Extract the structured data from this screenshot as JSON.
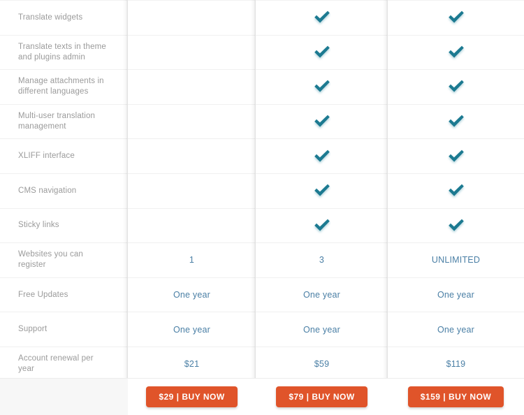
{
  "colors": {
    "feature_label": "#9a9a9a",
    "plan_value": "#4a7fa5",
    "check": "#1f7a91",
    "button_bg": "#e0542a",
    "button_text": "#ffffff",
    "row_divider": "#f0f0f0",
    "footer_bg": "#f7f7f7"
  },
  "features": [
    {
      "label": "Translate widgets"
    },
    {
      "label": "Translate texts in theme and plugins admin"
    },
    {
      "label": "Manage attachments in different languages"
    },
    {
      "label": "Multi-user translation management"
    },
    {
      "label": "XLIFF interface"
    },
    {
      "label": "CMS navigation"
    },
    {
      "label": "Sticky links"
    },
    {
      "label": "Websites you can register"
    },
    {
      "label": "Free Updates"
    },
    {
      "label": "Support"
    },
    {
      "label": "Account renewal per year"
    }
  ],
  "plans": [
    {
      "cells": [
        {
          "type": "empty",
          "value": ""
        },
        {
          "type": "empty",
          "value": ""
        },
        {
          "type": "empty",
          "value": ""
        },
        {
          "type": "empty",
          "value": ""
        },
        {
          "type": "empty",
          "value": ""
        },
        {
          "type": "empty",
          "value": ""
        },
        {
          "type": "empty",
          "value": ""
        },
        {
          "type": "text",
          "value": "1"
        },
        {
          "type": "text",
          "value": "One year"
        },
        {
          "type": "text",
          "value": "One year"
        },
        {
          "type": "text",
          "value": "$21"
        }
      ],
      "buy_label": "$29 | BUY NOW"
    },
    {
      "cells": [
        {
          "type": "check",
          "value": "check-icon"
        },
        {
          "type": "check",
          "value": "check-icon"
        },
        {
          "type": "check",
          "value": "check-icon"
        },
        {
          "type": "check",
          "value": "check-icon"
        },
        {
          "type": "check",
          "value": "check-icon"
        },
        {
          "type": "check",
          "value": "check-icon"
        },
        {
          "type": "check",
          "value": "check-icon"
        },
        {
          "type": "text",
          "value": "3"
        },
        {
          "type": "text",
          "value": "One year"
        },
        {
          "type": "text",
          "value": "One year"
        },
        {
          "type": "text",
          "value": "$59"
        }
      ],
      "buy_label": "$79 | BUY NOW"
    },
    {
      "cells": [
        {
          "type": "check",
          "value": "check-icon"
        },
        {
          "type": "check",
          "value": "check-icon"
        },
        {
          "type": "check",
          "value": "check-icon"
        },
        {
          "type": "check",
          "value": "check-icon"
        },
        {
          "type": "check",
          "value": "check-icon"
        },
        {
          "type": "check",
          "value": "check-icon"
        },
        {
          "type": "check",
          "value": "check-icon"
        },
        {
          "type": "text",
          "value": "UNLIMITED"
        },
        {
          "type": "text",
          "value": "One year"
        },
        {
          "type": "text",
          "value": "One year"
        },
        {
          "type": "text",
          "value": "$119"
        }
      ],
      "buy_label": "$159 | BUY NOW"
    }
  ]
}
